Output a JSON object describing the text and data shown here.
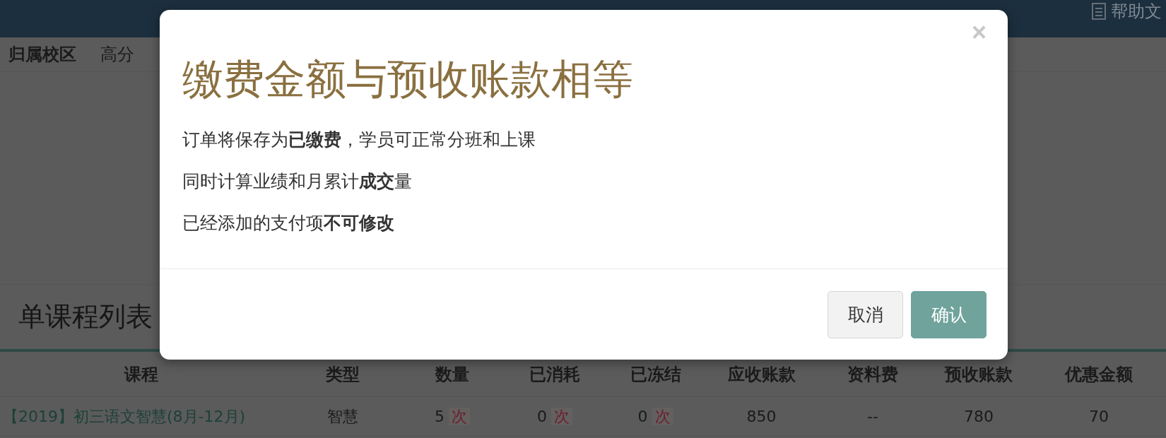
{
  "top_bar": {
    "help_link": "帮助文"
  },
  "campus": {
    "label": "归属校区",
    "value": "高分"
  },
  "section_title": "单课程列表",
  "table": {
    "columns": [
      "课程",
      "类型",
      "数量",
      "已消耗",
      "已冻结",
      "应收账款",
      "资料费",
      "预收账款",
      "优惠金额"
    ],
    "rows": [
      {
        "cells": [
          {
            "kind": "link",
            "text": "【2019】初三语文智慧(8月-12月)"
          },
          {
            "kind": "text",
            "text": "智慧"
          },
          {
            "kind": "count",
            "text": "5",
            "unit": "次"
          },
          {
            "kind": "count",
            "text": "0",
            "unit": "次"
          },
          {
            "kind": "count",
            "text": "0",
            "unit": "次"
          },
          {
            "kind": "text",
            "text": "850"
          },
          {
            "kind": "text",
            "text": "--"
          },
          {
            "kind": "text",
            "text": "780"
          },
          {
            "kind": "text",
            "text": "70"
          }
        ]
      }
    ]
  },
  "modal": {
    "close": "×",
    "title": "缴费金额与预收账款相等",
    "lines": [
      "订单将保存为**已缴费**，学员可正常分班和上课",
      "同时计算业绩和月累计**成交**量",
      "已经添加的支付项**不可修改**"
    ],
    "buttons": [
      {
        "label": "取消",
        "kind": "default"
      },
      {
        "label": "确认",
        "kind": "primary"
      }
    ]
  }
}
